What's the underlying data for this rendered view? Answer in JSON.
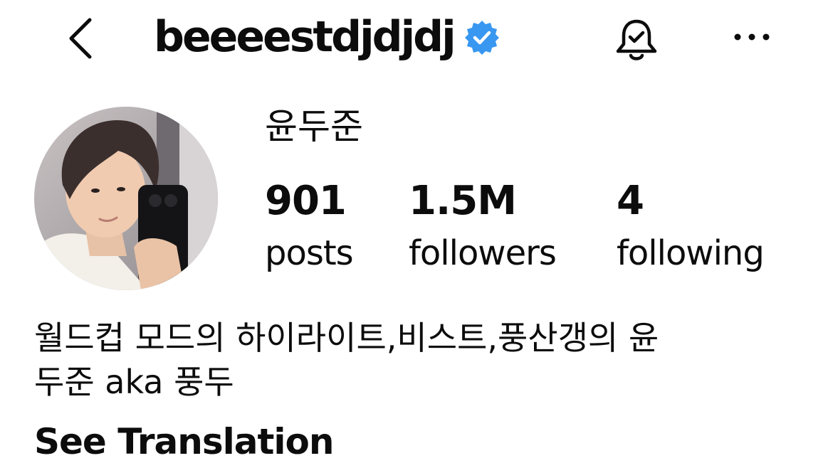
{
  "header": {
    "username": "beeeestdjdjdj",
    "verified": true,
    "back_icon": "chevron-left-icon",
    "bell_icon": "bell-check-icon",
    "more_icon": "ellipsis-icon",
    "verified_color": "#3897f0"
  },
  "profile": {
    "display_name": "윤두준",
    "avatar_alt": "profile photo",
    "stats": {
      "posts": {
        "value": "901",
        "label": "posts"
      },
      "followers": {
        "value": "1.5M",
        "label": "followers"
      },
      "following": {
        "value": "4",
        "label": "following"
      }
    },
    "bio_line_1": "월드컵 모드의 하이라이트,비스트,풍산갱의 윤",
    "bio_line_2": "두준 aka 풍두",
    "translate_label": "See Translation"
  }
}
